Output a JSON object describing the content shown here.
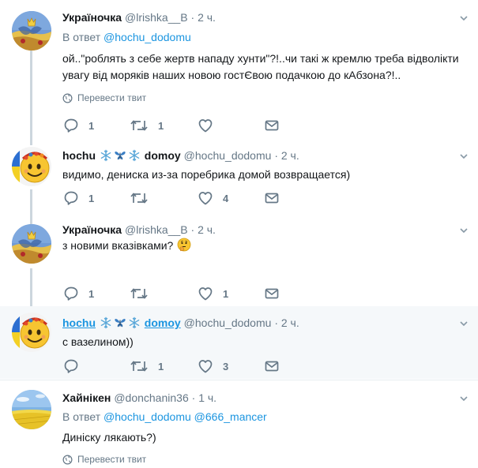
{
  "tweets": [
    {
      "name": "Україночка",
      "handle": "@lrishka__B",
      "dot": "·",
      "time": "2 ч.",
      "reply_prefix": "В ответ",
      "reply_to": "@hochu_dodomu",
      "text": "ой..\"роблять з себе жертв нападу хунти\"?!..чи такі ж кремлю треба відволікти увагу від моряків наших новою гостЄвою подачкою до кАбзона?!..",
      "translate": "Перевести твит",
      "reply_count": "1",
      "retweet_count": "1",
      "like_count": ""
    },
    {
      "name_part1": "hochu",
      "name_emojis": [
        "snowflake",
        "butterfly",
        "snowflake"
      ],
      "name_part2": "domoy",
      "handle": "@hochu_dodomu",
      "dot": "·",
      "time": "2 ч.",
      "text": "видимо, дениска  из-за  поребрика  домой  возвращается)",
      "reply_count": "1",
      "retweet_count": "",
      "like_count": "4"
    },
    {
      "name": "Україночка",
      "handle": "@lrishka__B",
      "dot": "·",
      "time": "2 ч.",
      "text": "з новими вказівками?",
      "text_emoji": "thinking-face",
      "reply_count": "1",
      "retweet_count": "",
      "like_count": "1"
    },
    {
      "name_part1": "hochu",
      "name_emojis": [
        "snowflake",
        "butterfly",
        "snowflake"
      ],
      "name_part2": "domoy",
      "handle": "@hochu_dodomu",
      "dot": "·",
      "time": "2 ч.",
      "text": "с вазелином))",
      "reply_count": "",
      "retweet_count": "1",
      "like_count": "3"
    },
    {
      "name": "Хайнікен",
      "handle": "@donchanin36",
      "dot": "·",
      "time": "1 ч.",
      "reply_prefix": "В ответ",
      "reply_to": "@hochu_dodomu",
      "reply_to2": "@666_mancer",
      "text": "Диніску лякають?)",
      "translate": "Перевести твит"
    }
  ],
  "icons": {
    "reply": "reply-icon",
    "retweet": "retweet-icon",
    "like": "heart-icon",
    "dm": "envelope-icon",
    "translate": "globe-icon",
    "more": "chevron-down-icon"
  },
  "colors": {
    "link": "#1b95e0",
    "secondary": "#657786",
    "thread_line": "#ccd6dd",
    "highlight_bg": "#f5f8fa"
  }
}
